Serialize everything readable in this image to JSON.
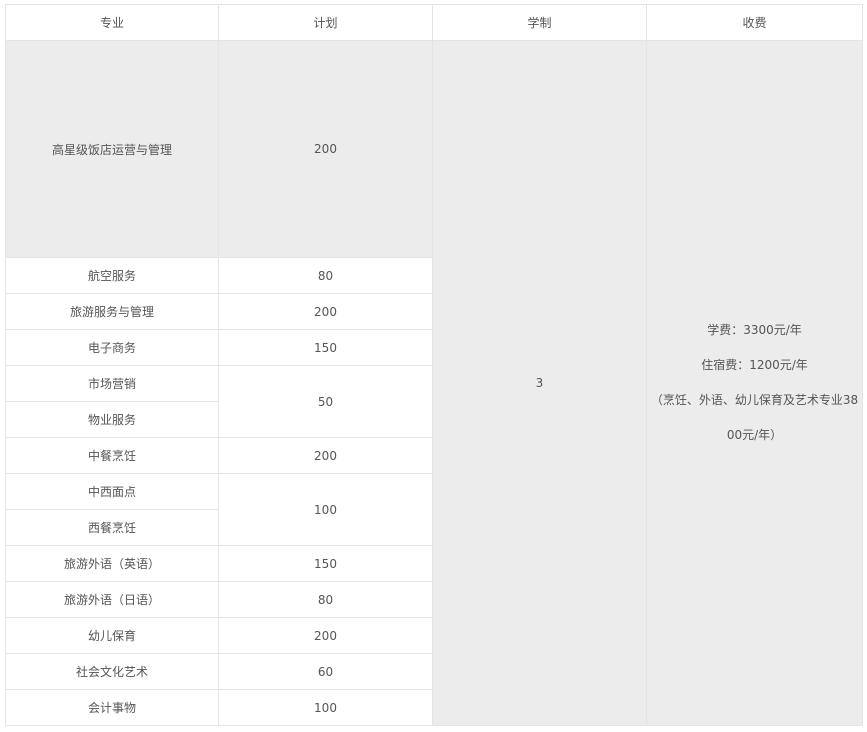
{
  "headers": [
    "专业",
    "计划",
    "学制",
    "收费"
  ],
  "rows": [
    {
      "major": "高星级饭店运营与管理",
      "plan": "200"
    },
    {
      "major": "航空服务",
      "plan": "80"
    },
    {
      "major": "旅游服务与管理",
      "plan": "200"
    },
    {
      "major": "电子商务",
      "plan": "150"
    },
    {
      "major": "市场营销",
      "plan": "50"
    },
    {
      "major": "物业服务",
      "plan": null
    },
    {
      "major": "中餐烹饪",
      "plan": "200"
    },
    {
      "major": "中西面点",
      "plan": "100"
    },
    {
      "major": "西餐烹饪",
      "plan": null
    },
    {
      "major": "旅游外语（英语）",
      "plan": "150"
    },
    {
      "major": "旅游外语（日语）",
      "plan": "80"
    },
    {
      "major": "幼儿保育",
      "plan": "200"
    },
    {
      "major": "社会文化艺术",
      "plan": "60"
    },
    {
      "major": "会计事物",
      "plan": "100"
    }
  ],
  "years": "3",
  "fee": {
    "tuition": "学费：3300元/年",
    "lodging": "住宿费：1200元/年",
    "note_line1": "（烹饪、外语、幼儿保育及艺术专业38",
    "note_line2": "00元/年）"
  }
}
